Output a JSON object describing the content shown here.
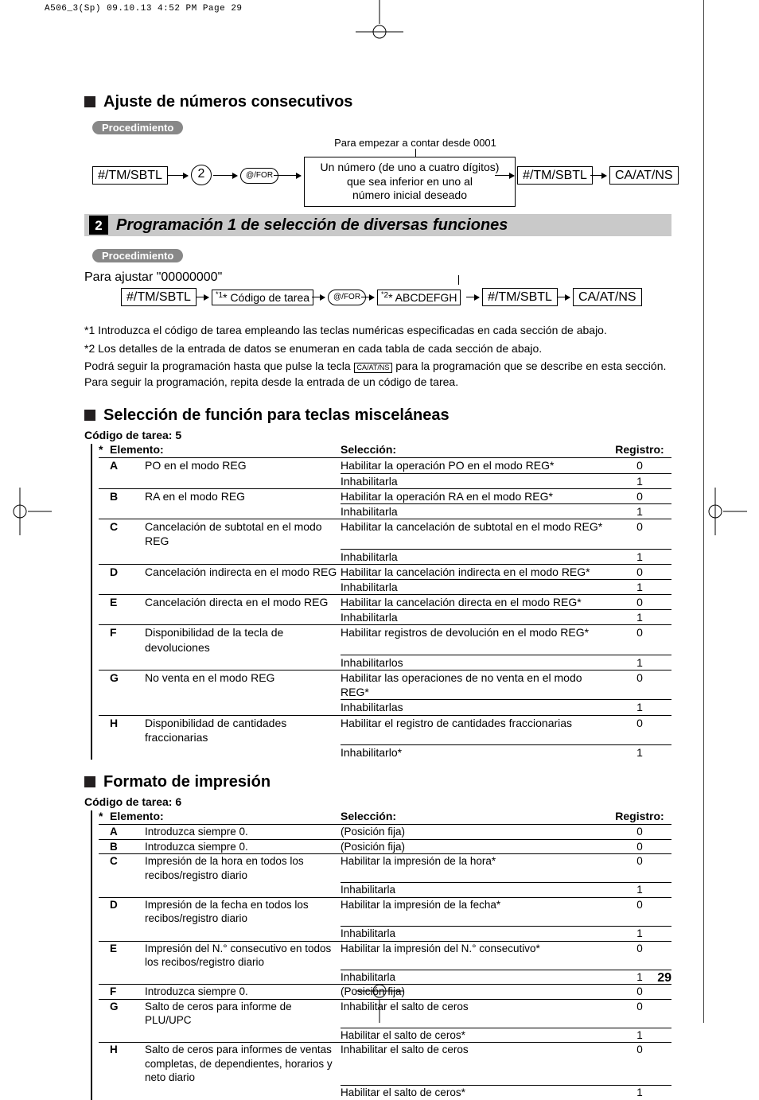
{
  "running_header": "A506_3(Sp)  09.10.13 4:52 PM  Page 29",
  "page_number": "29",
  "sec1": {
    "title": "Ajuste de números consecutivos",
    "proc": "Procedimiento",
    "above_box": "Para empezar a contar desde 0001",
    "big_box": "Un número (de uno a cuatro dígitos)\nque sea inferior en uno al\nnúmero inicial deseado",
    "k1": "#/TM/SBTL",
    "circ": "2",
    "oval": "@/FOR",
    "k2": "#/TM/SBTL",
    "k3": "CA/AT/NS"
  },
  "sec2": {
    "num": "2",
    "title": "Programación 1 de selección de diversas funciones",
    "proc": "Procedimiento",
    "above": "Para ajustar \"00000000\"",
    "k1": "#/TM/SBTL",
    "box1": "* Código de tarea",
    "sup1": "1",
    "oval": "@/FOR",
    "box2": "* ABCDEFGH",
    "sup2": "2",
    "k2": "#/TM/SBTL",
    "k3": "CA/AT/NS",
    "note1": "*1  Introduzca el código de tarea empleando las teclas numéricas especificadas en cada sección de abajo.",
    "note2": "*2  Los detalles de la entrada de datos se enumeran en cada tabla de cada sección de abajo.",
    "note3a": "Podrá seguir la programación hasta que pulse la tecla ",
    "note3k": "CA/AT/NS",
    "note3b": " para la programación que se describe en esta sección. Para seguir la programación, repita desde la entrada de un código de tarea."
  },
  "sec3": {
    "title": "Selección de función para teclas misceláneas",
    "task": "Código de tarea: 5",
    "h_elem": "Elemento:",
    "h_sel": "Selección:",
    "h_reg": "Registro:",
    "star": "*",
    "rows": [
      {
        "a": "A",
        "b": "PO en el modo REG",
        "c": "Habilitar la operación PO en el modo REG*",
        "d": "0",
        "c2": "Inhabilitarla",
        "d2": "1"
      },
      {
        "a": "B",
        "b": "RA en el modo REG",
        "c": "Habilitar la operación RA en el modo REG*",
        "d": "0",
        "c2": "Inhabilitarla",
        "d2": "1"
      },
      {
        "a": "C",
        "b": "Cancelación de subtotal en el modo REG",
        "c": "Habilitar la cancelación de subtotal en el modo REG*",
        "d": "0",
        "c2": "Inhabilitarla",
        "d2": "1"
      },
      {
        "a": "D",
        "b": "Cancelación indirecta en el modo REG",
        "c": "Habilitar la cancelación indirecta en el modo REG*",
        "d": "0",
        "c2": "Inhabilitarla",
        "d2": "1"
      },
      {
        "a": "E",
        "b": "Cancelación directa en el modo REG",
        "c": "Habilitar la cancelación directa en el modo REG*",
        "d": "0",
        "c2": "Inhabilitarla",
        "d2": "1"
      },
      {
        "a": "F",
        "b": "Disponibilidad de la tecla de devoluciones",
        "c": "Habilitar registros de devolución en el modo REG*",
        "d": "0",
        "c2": "Inhabilitarlos",
        "d2": "1"
      },
      {
        "a": "G",
        "b": "No venta en el modo REG",
        "c": "Habilitar las operaciones de no venta en el modo REG*",
        "d": "0",
        "c2": "Inhabilitarlas",
        "d2": "1"
      },
      {
        "a": "H",
        "b": "Disponibilidad de cantidades fraccionarias",
        "c": "Habilitar el registro de cantidades fraccionarias",
        "d": "0",
        "c2": "Inhabilitarlo*",
        "d2": "1"
      }
    ]
  },
  "sec4": {
    "title": "Formato de impresión",
    "task": "Código de tarea: 6",
    "h_elem": "Elemento:",
    "h_sel": "Selección:",
    "h_reg": "Registro:",
    "star": "*",
    "rows": [
      {
        "a": "A",
        "b": "Introduzca siempre 0.",
        "c": "(Posición fija)",
        "d": "0"
      },
      {
        "a": "B",
        "b": "Introduzca siempre 0.",
        "c": "(Posición fija)",
        "d": "0"
      },
      {
        "a": "C",
        "b": "Impresión de la hora en todos los recibos/registro diario",
        "c": "Habilitar la impresión de la hora*",
        "d": "0",
        "c2": "Inhabilitarla",
        "d2": "1"
      },
      {
        "a": "D",
        "b": "Impresión de la fecha en todos los recibos/registro diario",
        "c": "Habilitar la impresión de la fecha*",
        "d": "0",
        "c2": "Inhabilitarla",
        "d2": "1"
      },
      {
        "a": "E",
        "b": "Impresión del N.° consecutivo en todos los recibos/registro diario",
        "c": "Habilitar la impresión del N.° consecutivo*",
        "d": "0",
        "c2": "Inhabilitarla",
        "d2": "1"
      },
      {
        "a": "F",
        "b": "Introduzca siempre 0.",
        "c": "(Posición fija)",
        "d": "0"
      },
      {
        "a": "G",
        "b": "Salto de ceros para informe de PLU/UPC",
        "c": "Inhabilitar el salto de ceros",
        "d": "0",
        "c2": "Habilitar el salto de ceros*",
        "d2": "1"
      },
      {
        "a": "H",
        "b": "Salto de ceros para informes de ventas completas, de dependientes, horarios y neto diario",
        "c": "Inhabilitar el salto de ceros",
        "d": "0",
        "c2": "Habilitar el salto de ceros*",
        "d2": "1"
      }
    ]
  }
}
